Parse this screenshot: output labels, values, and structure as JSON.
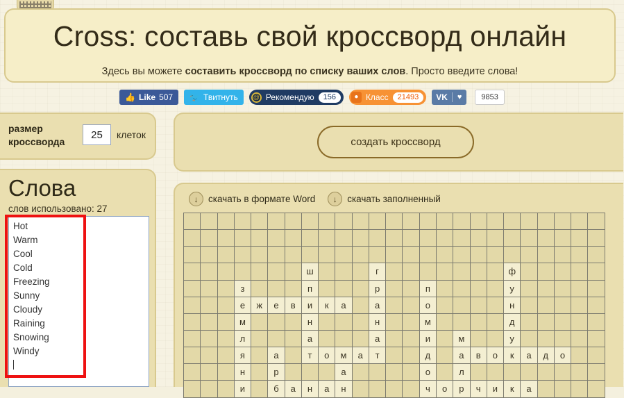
{
  "logo": {
    "name": "site-logo"
  },
  "header": {
    "title": "Cross: составь свой кроссворд онлайн",
    "subtitle_before": "Здесь вы можете ",
    "subtitle_bold": "составить кроссворд по списку ваших слов",
    "subtitle_after": ". Просто введите слова!"
  },
  "social": {
    "facebook": {
      "icon": "thumbs-up-icon",
      "label": "Like",
      "count": "507",
      "color": "#3b5998"
    },
    "twitter": {
      "icon": "twitter-bird-icon",
      "label": "Твитнуть",
      "color": "#32b3ea"
    },
    "mailru": {
      "icon": "at-icon",
      "label": "Рекомендую",
      "count": "156",
      "color": "#1f3b63"
    },
    "odnoklassniki": {
      "icon": "ok-icon",
      "label": "Класс",
      "count": "21493",
      "color": "#f79234"
    },
    "vk": {
      "icon": "vk-icon",
      "label": "VK",
      "heart": "♥",
      "count": "9853",
      "color": "#5a7ba6"
    }
  },
  "size_panel": {
    "label_line1": "размер",
    "label_line2": "кроссворда",
    "value": "25",
    "units": "клеток"
  },
  "words_panel": {
    "title": "Слова",
    "count_label": "слов использовано: 27",
    "words": [
      "Hot",
      "Warm",
      "Cool",
      "Cold",
      "Freezing",
      "Sunny",
      "Cloudy",
      "Raining",
      "Snowing",
      "Windy"
    ]
  },
  "actions": {
    "create_button": "создать кроссворд",
    "download_word": "скачать в формате Word",
    "download_filled": "скачать заполненный",
    "download_icon": "download-arrow-icon"
  },
  "annotation": {
    "shape": "red-rectangle",
    "color": "#ee1111"
  },
  "crossword": {
    "cols": 25,
    "rows": 10,
    "cell_empty_color": "#e3d9a8",
    "cell_filled_color": "#f4efd2",
    "grid_line_color": "#7b7a6e",
    "cells": [
      [
        "",
        "",
        "",
        "",
        "",
        "",
        "",
        "",
        "",
        "",
        "",
        "",
        "",
        "",
        "",
        "",
        "",
        "",
        "",
        "",
        "",
        "",
        "",
        "",
        ""
      ],
      [
        "",
        "",
        "",
        "",
        "",
        "",
        "",
        "",
        "",
        "",
        "",
        "",
        "",
        "",
        "",
        "",
        "",
        "",
        "",
        "",
        "",
        "",
        "",
        "",
        ""
      ],
      [
        "",
        "",
        "",
        "",
        "",
        "",
        "",
        "",
        "",
        "",
        "",
        "",
        "",
        "",
        "",
        "",
        "",
        "",
        "",
        "",
        "",
        "",
        "",
        "",
        ""
      ],
      [
        "",
        "",
        "",
        "",
        "",
        "",
        "",
        "ш",
        "",
        "",
        "",
        "г",
        "",
        "",
        "",
        "",
        "",
        "",
        "",
        "ф",
        "",
        "",
        "",
        "",
        ""
      ],
      [
        "",
        "",
        "",
        "з",
        "",
        "",
        "",
        "п",
        "",
        "",
        "",
        "р",
        "",
        "",
        "п",
        "",
        "",
        "",
        "",
        "у",
        "",
        "",
        "",
        "",
        ""
      ],
      [
        "",
        "",
        "",
        "е",
        "ж",
        "е",
        "в",
        "и",
        "к",
        "а",
        "",
        "а",
        "",
        "",
        "о",
        "",
        "",
        "",
        "",
        "н",
        "",
        "",
        "",
        "",
        ""
      ],
      [
        "",
        "",
        "",
        "м",
        "",
        "",
        "",
        "н",
        "",
        "",
        "",
        "н",
        "",
        "",
        "м",
        "",
        "",
        "",
        "",
        "д",
        "",
        "",
        "",
        "",
        ""
      ],
      [
        "",
        "",
        "",
        "л",
        "",
        "",
        "",
        "а",
        "",
        "",
        "",
        "а",
        "",
        "",
        "и",
        "",
        "м",
        "",
        "",
        "у",
        "",
        "",
        "",
        "",
        ""
      ],
      [
        "",
        "",
        "",
        "я",
        "",
        "а",
        "",
        "т",
        "о",
        "м",
        "а",
        "т",
        "",
        "",
        "д",
        "",
        "а",
        "в",
        "о",
        "к",
        "а",
        "д",
        "о",
        "",
        ""
      ],
      [
        "",
        "",
        "",
        "н",
        "",
        "р",
        "",
        "",
        "",
        "а",
        "",
        "",
        "",
        "",
        "о",
        "",
        "л",
        "",
        "",
        "",
        "",
        "",
        "",
        "",
        ""
      ]
    ],
    "partial_last_row": [
      "",
      "",
      "",
      "и",
      "",
      "б",
      "а",
      "н",
      "а",
      "н",
      "",
      "",
      "",
      "",
      "ч",
      "о",
      "р",
      "ч",
      "и",
      "к",
      "а",
      "",
      "",
      "",
      ""
    ]
  }
}
